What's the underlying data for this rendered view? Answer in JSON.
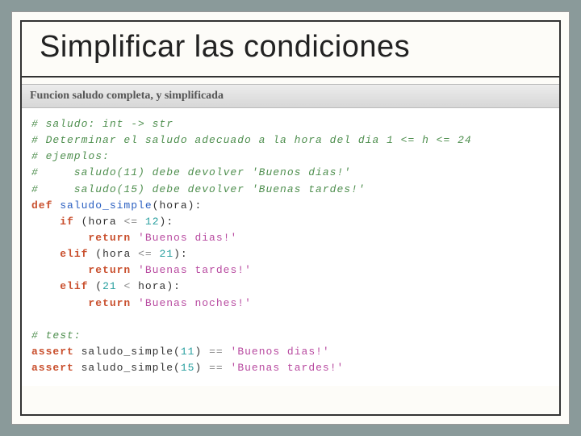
{
  "title": "Simplificar las condiciones",
  "caption": "Funcion saludo completa, y simplificada",
  "comments": {
    "c1": "# saludo: int -> str",
    "c2": "# Determinar el saludo adecuado a la hora del dia 1 <= h <= 24",
    "c3": "# ejemplos:",
    "c4": "#     saludo(11) debe devolver 'Buenos dias!'",
    "c5": "#     saludo(15) debe devolver 'Buenas tardes!'",
    "ctest": "# test:"
  },
  "kw": {
    "def": "def",
    "if": "if",
    "elif": "elif",
    "return": "return",
    "assert": "assert"
  },
  "fn": {
    "name": "saludo_simple",
    "param": "hora"
  },
  "nums": {
    "n12": "12",
    "n21a": "21",
    "n21b": "21",
    "n11": "11",
    "n15": "15"
  },
  "ops": {
    "le1": "<=",
    "le2": "<=",
    "lt": "<",
    "eq1": "==",
    "eq2": "=="
  },
  "strs": {
    "dias": "'Buenos dias!'",
    "tardes": "'Buenas tardes!'",
    "noches": "'Buenas noches!'",
    "adias": "'Buenos dias!'",
    "atardes": "'Buenas tardes!'"
  },
  "ids": {
    "hora1": "hora",
    "hora2": "hora",
    "hora3": "hora",
    "call1": "saludo_simple",
    "call2": "saludo_simple"
  }
}
